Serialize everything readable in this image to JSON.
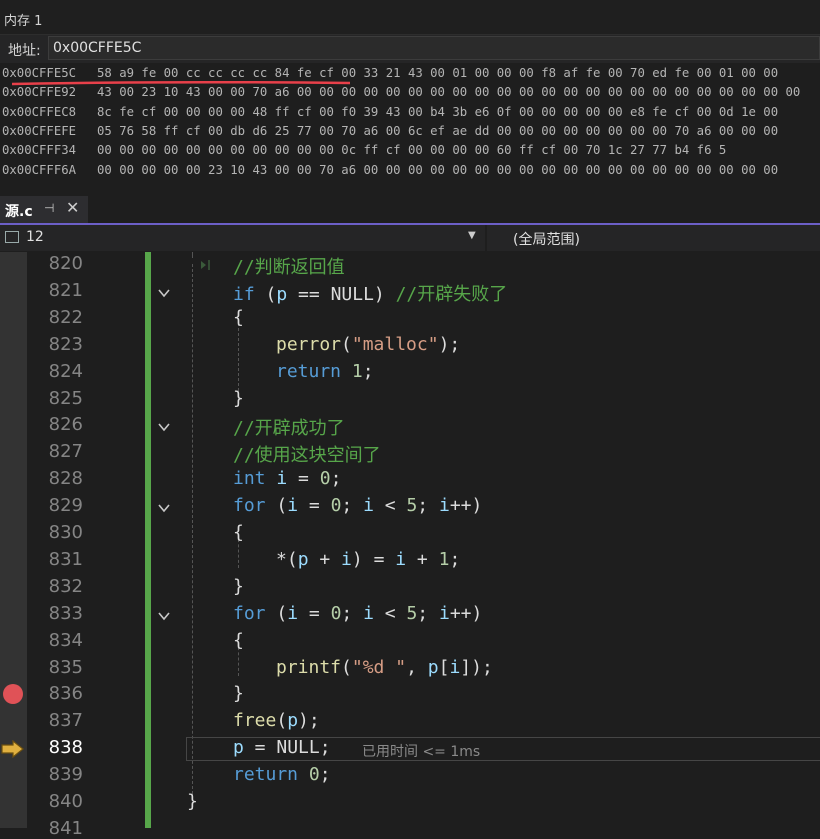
{
  "memory": {
    "title": "内存 1",
    "address_label": "地址:",
    "address_value": "0x00CFFE5C",
    "rows": [
      {
        "addr": "0x00CFFE5C",
        "bytes": "58 a9 fe 00 cc cc cc cc 84 fe cf 00 33 21 43 00 01 00 00 00 f8 af fe 00 70 ed fe 00 01 00 00"
      },
      {
        "addr": "0x00CFFE92",
        "bytes": "43 00 23 10 43 00 00 70 a6 00 00 00 00 00 00 00 00 00 00 00 00 00 00 00 00 00 00 00 00 00 00 00"
      },
      {
        "addr": "0x00CFFEC8",
        "bytes": "8c fe cf 00 00 00 00 48 ff cf 00 f0 39 43 00 b4 3b e6 0f 00 00 00 00 00 e8 fe cf 00 0d 1e 00"
      },
      {
        "addr": "0x00CFFEFE",
        "bytes": "05 76 58 ff cf 00 db d6 25 77 00 70 a6 00 6c ef ae dd 00 00 00 00 00 00 00 00 70 a6 00 00 00"
      },
      {
        "addr": "0x00CFFF34",
        "bytes": "00 00 00 00 00 00 00 00 00 00 00 0c ff cf 00 00 00 00 60 ff cf 00 70 1c 27 77 b4 f6 5"
      },
      {
        "addr": "0x00CFFF6A",
        "bytes": "00 00 00 00 00 23 10 43 00 00 70 a6 00 00 00 00 00 00 00 00 00 00 00 00 00 00 00 00 00 00 00"
      }
    ]
  },
  "tab": {
    "name": "源.c",
    "pin": "⊣",
    "close": "✕"
  },
  "navbar": {
    "left_value": "12",
    "right_value": "(全局范围)"
  },
  "colors": {
    "keyword": "#569cd6",
    "comment": "#57a64a",
    "string": "#d69d85",
    "breakpoint": "#e05257",
    "arrow": "#e0b040",
    "accent": "#6c5fc7"
  },
  "editor": {
    "current_line": "838",
    "breakpoint_line": "836",
    "elapsed_hint": "已用时间 <= 1ms",
    "lines": [
      {
        "no": "820",
        "indent": 0,
        "parts": [
          {
            "t": "//判断返回值",
            "c": "cm"
          }
        ]
      },
      {
        "no": "821",
        "indent": 0,
        "parts": [
          {
            "t": "if",
            "c": "kw"
          },
          {
            "t": " (",
            "c": ""
          },
          {
            "t": "p",
            "c": "vr"
          },
          {
            "t": " == NULL) ",
            "c": ""
          },
          {
            "t": "//开辟失败了",
            "c": "cm"
          }
        ]
      },
      {
        "no": "822",
        "indent": 0,
        "parts": [
          {
            "t": "{",
            "c": ""
          }
        ]
      },
      {
        "no": "823",
        "indent": 1,
        "parts": [
          {
            "t": "perror",
            "c": "fn"
          },
          {
            "t": "(",
            "c": ""
          },
          {
            "t": "\"malloc\"",
            "c": "st"
          },
          {
            "t": ");",
            "c": ""
          }
        ]
      },
      {
        "no": "824",
        "indent": 1,
        "parts": [
          {
            "t": "return",
            "c": "kw"
          },
          {
            "t": " ",
            "c": ""
          },
          {
            "t": "1",
            "c": "nm"
          },
          {
            "t": ";",
            "c": ""
          }
        ]
      },
      {
        "no": "825",
        "indent": 0,
        "parts": [
          {
            "t": "}",
            "c": ""
          }
        ]
      },
      {
        "no": "826",
        "indent": 0,
        "parts": [
          {
            "t": "//开辟成功了",
            "c": "cm"
          }
        ]
      },
      {
        "no": "827",
        "indent": 0,
        "parts": [
          {
            "t": "//使用这块空间了",
            "c": "cm"
          }
        ]
      },
      {
        "no": "828",
        "indent": 0,
        "parts": [
          {
            "t": "int",
            "c": "kw"
          },
          {
            "t": " ",
            "c": ""
          },
          {
            "t": "i",
            "c": "vr"
          },
          {
            "t": " = ",
            "c": ""
          },
          {
            "t": "0",
            "c": "nm"
          },
          {
            "t": ";",
            "c": ""
          }
        ]
      },
      {
        "no": "829",
        "indent": 0,
        "parts": [
          {
            "t": "for",
            "c": "kw"
          },
          {
            "t": " (",
            "c": ""
          },
          {
            "t": "i",
            "c": "vr"
          },
          {
            "t": " = ",
            "c": ""
          },
          {
            "t": "0",
            "c": "nm"
          },
          {
            "t": "; ",
            "c": ""
          },
          {
            "t": "i",
            "c": "vr"
          },
          {
            "t": " < ",
            "c": ""
          },
          {
            "t": "5",
            "c": "nm"
          },
          {
            "t": "; ",
            "c": ""
          },
          {
            "t": "i",
            "c": "vr"
          },
          {
            "t": "++)",
            "c": ""
          }
        ]
      },
      {
        "no": "830",
        "indent": 0,
        "parts": [
          {
            "t": "{",
            "c": ""
          }
        ]
      },
      {
        "no": "831",
        "indent": 1,
        "parts": [
          {
            "t": "*(",
            "c": ""
          },
          {
            "t": "p",
            "c": "vr"
          },
          {
            "t": " + ",
            "c": ""
          },
          {
            "t": "i",
            "c": "vr"
          },
          {
            "t": ") = ",
            "c": ""
          },
          {
            "t": "i",
            "c": "vr"
          },
          {
            "t": " + ",
            "c": ""
          },
          {
            "t": "1",
            "c": "nm"
          },
          {
            "t": ";",
            "c": ""
          }
        ]
      },
      {
        "no": "832",
        "indent": 0,
        "parts": [
          {
            "t": "}",
            "c": ""
          }
        ]
      },
      {
        "no": "833",
        "indent": 0,
        "parts": [
          {
            "t": "for",
            "c": "kw"
          },
          {
            "t": " (",
            "c": ""
          },
          {
            "t": "i",
            "c": "vr"
          },
          {
            "t": " = ",
            "c": ""
          },
          {
            "t": "0",
            "c": "nm"
          },
          {
            "t": "; ",
            "c": ""
          },
          {
            "t": "i",
            "c": "vr"
          },
          {
            "t": " < ",
            "c": ""
          },
          {
            "t": "5",
            "c": "nm"
          },
          {
            "t": "; ",
            "c": ""
          },
          {
            "t": "i",
            "c": "vr"
          },
          {
            "t": "++)",
            "c": ""
          }
        ]
      },
      {
        "no": "834",
        "indent": 0,
        "parts": [
          {
            "t": "{",
            "c": ""
          }
        ]
      },
      {
        "no": "835",
        "indent": 1,
        "parts": [
          {
            "t": "printf",
            "c": "fn"
          },
          {
            "t": "(",
            "c": ""
          },
          {
            "t": "\"%d \"",
            "c": "st"
          },
          {
            "t": ", ",
            "c": ""
          },
          {
            "t": "p",
            "c": "vr"
          },
          {
            "t": "[",
            "c": ""
          },
          {
            "t": "i",
            "c": "vr"
          },
          {
            "t": "]);",
            "c": ""
          }
        ]
      },
      {
        "no": "836",
        "indent": 0,
        "parts": [
          {
            "t": "}",
            "c": ""
          }
        ]
      },
      {
        "no": "837",
        "indent": 0,
        "parts": [
          {
            "t": "free",
            "c": "fn"
          },
          {
            "t": "(",
            "c": ""
          },
          {
            "t": "p",
            "c": "vr"
          },
          {
            "t": ");",
            "c": ""
          }
        ]
      },
      {
        "no": "838",
        "indent": 0,
        "parts": [
          {
            "t": "p",
            "c": "vr"
          },
          {
            "t": " = NULL;",
            "c": ""
          }
        ]
      },
      {
        "no": "839",
        "indent": 0,
        "parts": [
          {
            "t": "return",
            "c": "kw"
          },
          {
            "t": " ",
            "c": ""
          },
          {
            "t": "0",
            "c": "nm"
          },
          {
            "t": ";",
            "c": ""
          }
        ]
      },
      {
        "no": "840",
        "indent": -1,
        "parts": [
          {
            "t": "}",
            "c": ""
          }
        ]
      },
      {
        "no": "841",
        "indent": 0,
        "parts": []
      }
    ]
  }
}
